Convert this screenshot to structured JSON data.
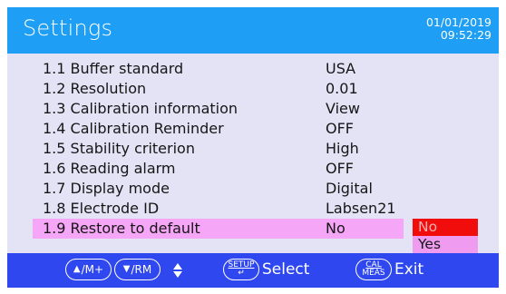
{
  "header": {
    "title": "Settings",
    "date": "01/01/2019",
    "time": "09:52:29"
  },
  "menu": {
    "items": [
      {
        "label": "1.1 Buffer standard",
        "value": "USA"
      },
      {
        "label": "1.2 Resolution",
        "value": "0.01"
      },
      {
        "label": "1.3 Calibration information",
        "value": "View"
      },
      {
        "label": "1.4 Calibration Reminder",
        "value": "OFF"
      },
      {
        "label": "1.5 Stability criterion",
        "value": "High"
      },
      {
        "label": "1.6 Reading alarm",
        "value": "OFF"
      },
      {
        "label": "1.7 Display mode",
        "value": "Digital"
      },
      {
        "label": "1.8 Electrode ID",
        "value": "Labsen21"
      },
      {
        "label": "1.9 Restore to default",
        "value": "No"
      }
    ],
    "selected_index": 8
  },
  "dropdown": {
    "options": [
      "No",
      "Yes"
    ],
    "highlighted": "No"
  },
  "footer": {
    "up_key": "/M+",
    "down_key": "/RM",
    "setup_key_top": "SETUP",
    "setup_key_bottom": "↵",
    "select_label": "Select",
    "cal_key_top": "CAL",
    "cal_key_bottom": "MEAS",
    "exit_label": "Exit"
  },
  "colors": {
    "header": "#1e9ef5",
    "background": "#e4e3f6",
    "selection": "#f5a6f6",
    "dropdown_active": "#f20d0d",
    "footer": "#2f47ef"
  },
  "icons": [
    "up-triangle-icon",
    "down-triangle-icon",
    "up-down-arrow-icon",
    "enter-icon"
  ]
}
